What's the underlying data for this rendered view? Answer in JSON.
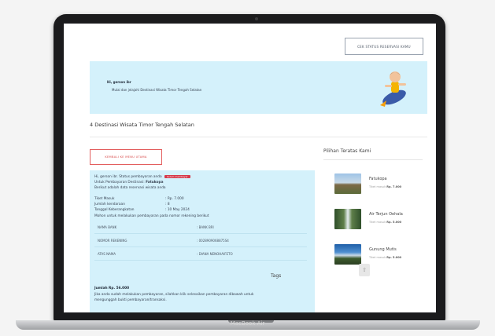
{
  "device_label": "MacBook Air",
  "header": {
    "cek_status_button": "CEK STATUS RESERVASI KAMU"
  },
  "hero": {
    "greeting": "Hi, gerson ibr",
    "subtitle": "Mulai dan jelajahi Destinasi Wisata Timor Tengah Selatan"
  },
  "destinations_title": "4 Destinasi Wisata Timor Tengah Selatan",
  "back_button": "KEMBALI KE MENU UTAMA",
  "reservation": {
    "status_line": "Hi, gerson ibr. Status pembayaran anda",
    "status_badge": "belum membayar",
    "for_line_prefix": "Untuk Pembayaran Destinasi:",
    "destination": "Fatukopa",
    "intro": "Berikut adalah data reservasi wisata anda",
    "fields": [
      {
        "label": "Tiket Masuk",
        "value": ": Rp. 7.000"
      },
      {
        "label": "Jumlah kendaraan",
        "value": ": 8"
      },
      {
        "label": "Tanggal Keberangkatan",
        "value": ": 10 May 2024"
      }
    ],
    "payment_note": "Mohon untuk melakukan pembayaran pada nomor rekening berikut",
    "bank_rows": [
      {
        "label": "NAMA BANK",
        "value": ": BANK BRI"
      },
      {
        "label": "NOMOR REKENING",
        "value": ": 0028909068875S4"
      },
      {
        "label": "ATAS NAMA",
        "value": ": DIANA NENOHAIFETO"
      }
    ],
    "total": "Jumlah Rp. 56.000",
    "final_note_1": "Jika anda sudah melakukan pembayaran, silahkan klik selesaikan pembayaran dibawah untuk",
    "final_note_2": "mengunggah bukti pembayaran/transaksi."
  },
  "sidebar": {
    "title": "Pilihan Teratas Kami",
    "picks": [
      {
        "name": "Fatukopa",
        "price_label": "Tiket masuk",
        "price": "Rp. 7.000"
      },
      {
        "name": "Air Terjun Oehala",
        "price_label": "Tiket masuk",
        "price": "Rp. 5.000"
      },
      {
        "name": "Gunung Mutis",
        "price_label": "Tiket masuk",
        "price": "Rp. 5.000"
      }
    ],
    "tags_title": "Tags"
  },
  "icons": {
    "scroll_top": "chevron-up-icon"
  }
}
